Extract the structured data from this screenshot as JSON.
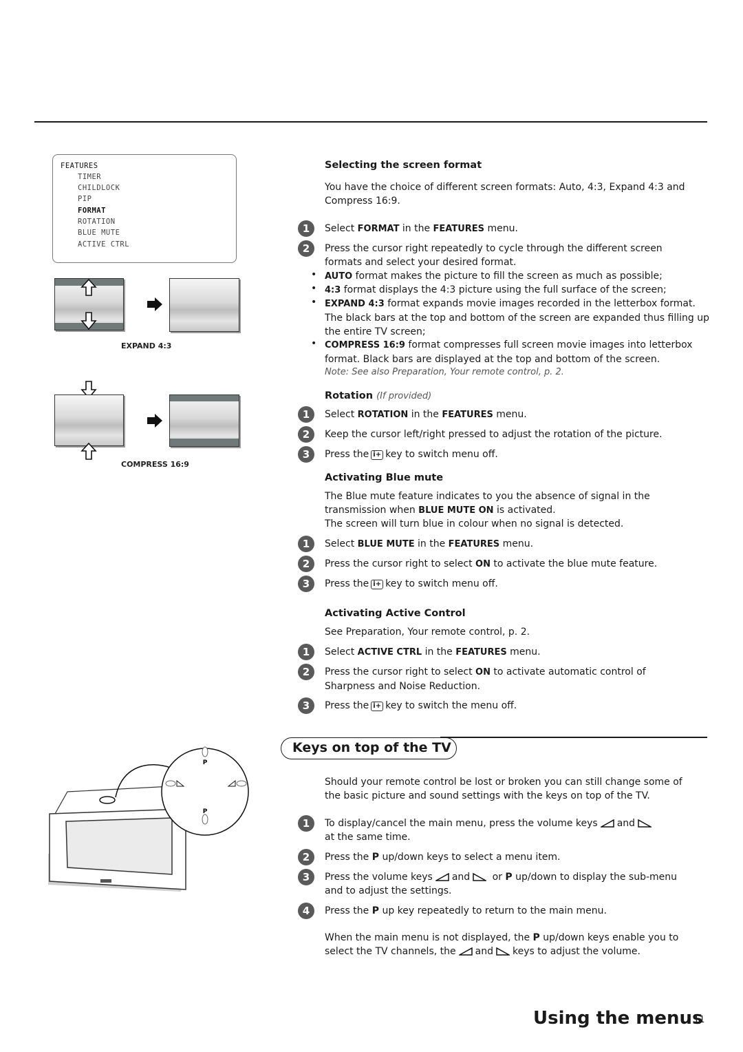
{
  "menu": {
    "title": "FEATURES",
    "items": [
      "TIMER",
      "CHILDLOCK",
      "PIP",
      "FORMAT",
      "ROTATION",
      "BLUE MUTE",
      "ACTIVE CTRL"
    ],
    "selected": "FORMAT"
  },
  "diagrams": {
    "expand_caption": "EXPAND 4:3",
    "compress_caption": "COMPRESS 16:9"
  },
  "screen_format": {
    "heading": "Selecting the screen format",
    "intro": "You have the choice of different screen formats: Auto, 4:3, Expand 4:3 and Compress 16:9.",
    "steps": [
      {
        "n": "1",
        "pre": "Select ",
        "b1": "FORMAT",
        "mid": " in the ",
        "b2": "FEATURES",
        "post": " menu."
      },
      {
        "n": "2",
        "text": "Press the cursor right repeatedly to cycle through the different screen formats and select your desired format."
      }
    ],
    "bullets": [
      {
        "b": "AUTO",
        "text": " format makes the picture to fill the screen as much as possible;"
      },
      {
        "b": "4:3",
        "text": " format displays the 4:3 picture using the full surface of the screen;"
      },
      {
        "b": "EXPAND 4:3",
        "text": " format expands movie images recorded in the letterbox format. The black bars at the top and bottom of the screen are expanded thus filling up the entire TV screen;"
      },
      {
        "b": "COMPRESS 16:9",
        "text": " format compresses full screen movie images into letterbox format. Black bars are displayed at the top and bottom of the screen."
      }
    ],
    "note": "Note: See also Preparation, Your remote control, p. 2."
  },
  "rotation": {
    "heading": "Rotation",
    "heading_note": "(If provided)",
    "steps": [
      {
        "n": "1",
        "pre": "Select ",
        "b1": "ROTATION",
        "mid": " in the ",
        "b2": "FEATURES",
        "post": " menu."
      },
      {
        "n": "2",
        "text": "Keep the cursor left/right pressed to adjust the rotation of the picture."
      },
      {
        "n": "3",
        "pre": "Press the",
        "key": "i+",
        "post": "key to switch menu off."
      }
    ]
  },
  "blue_mute": {
    "heading": "Activating Blue mute",
    "intro_pre": "The Blue mute feature indicates to you the absence of signal in the transmission when ",
    "intro_b": "BLUE MUTE ON",
    "intro_post": " is activated.",
    "intro2": "The screen will turn blue in colour when no signal is detected.",
    "steps": [
      {
        "n": "1",
        "pre": "Select ",
        "b1": "BLUE MUTE",
        "mid": " in the ",
        "b2": "FEATURES",
        "post": " menu."
      },
      {
        "n": "2",
        "pre": "Press the cursor right to select ",
        "b1": "ON",
        "post": " to activate the blue mute feature."
      },
      {
        "n": "3",
        "pre": "Press the",
        "key": "i+",
        "post": "key to switch menu off."
      }
    ]
  },
  "active_control": {
    "heading": "Activating Active Control",
    "intro": "See Preparation, Your remote control, p. 2.",
    "steps": [
      {
        "n": "1",
        "pre": "Select ",
        "b1": "ACTIVE CTRL",
        "mid": " in the ",
        "b2": "FEATURES",
        "post": " menu."
      },
      {
        "n": "2",
        "pre": "Press the cursor right to select ",
        "b1": "ON",
        "post": " to activate automatic control of Sharpness and Noise Reduction."
      },
      {
        "n": "3",
        "pre": "Press the",
        "key": "i+",
        "post": "key to switch the menu off."
      }
    ]
  },
  "keys_on_top": {
    "title": "Keys on top of the TV",
    "intro": "Should your remote control be lost or broken you can still change some of the basic picture and sound settings with the keys on top of the TV.",
    "steps": [
      {
        "n": "1",
        "pre": "To display/cancel the main menu, press the volume keys",
        "and": "and",
        "post": "at the same time."
      },
      {
        "n": "2",
        "pre": "Press the ",
        "b1": "P",
        "post": " up/down keys to select a menu item."
      },
      {
        "n": "3",
        "pre": "Press the volume keys",
        "and": "and",
        "mid": "or ",
        "b1": "P",
        "post": " up/down to display the sub-menu and to adjust the settings."
      },
      {
        "n": "4",
        "pre": "Press the ",
        "b1": "P",
        "post": " up key repeatedly to return to the main menu."
      }
    ],
    "outro_pre": "When the main menu is not displayed, the ",
    "outro_b": "P",
    "outro_mid": " up/down keys enable you to select the TV channels, the",
    "outro_and": "and",
    "outro_post": "keys to adjust the volume.",
    "tv_labels": {
      "p_up": "P",
      "p_down": "P"
    }
  },
  "footer": {
    "title": "Using the menus",
    "page": "11"
  }
}
